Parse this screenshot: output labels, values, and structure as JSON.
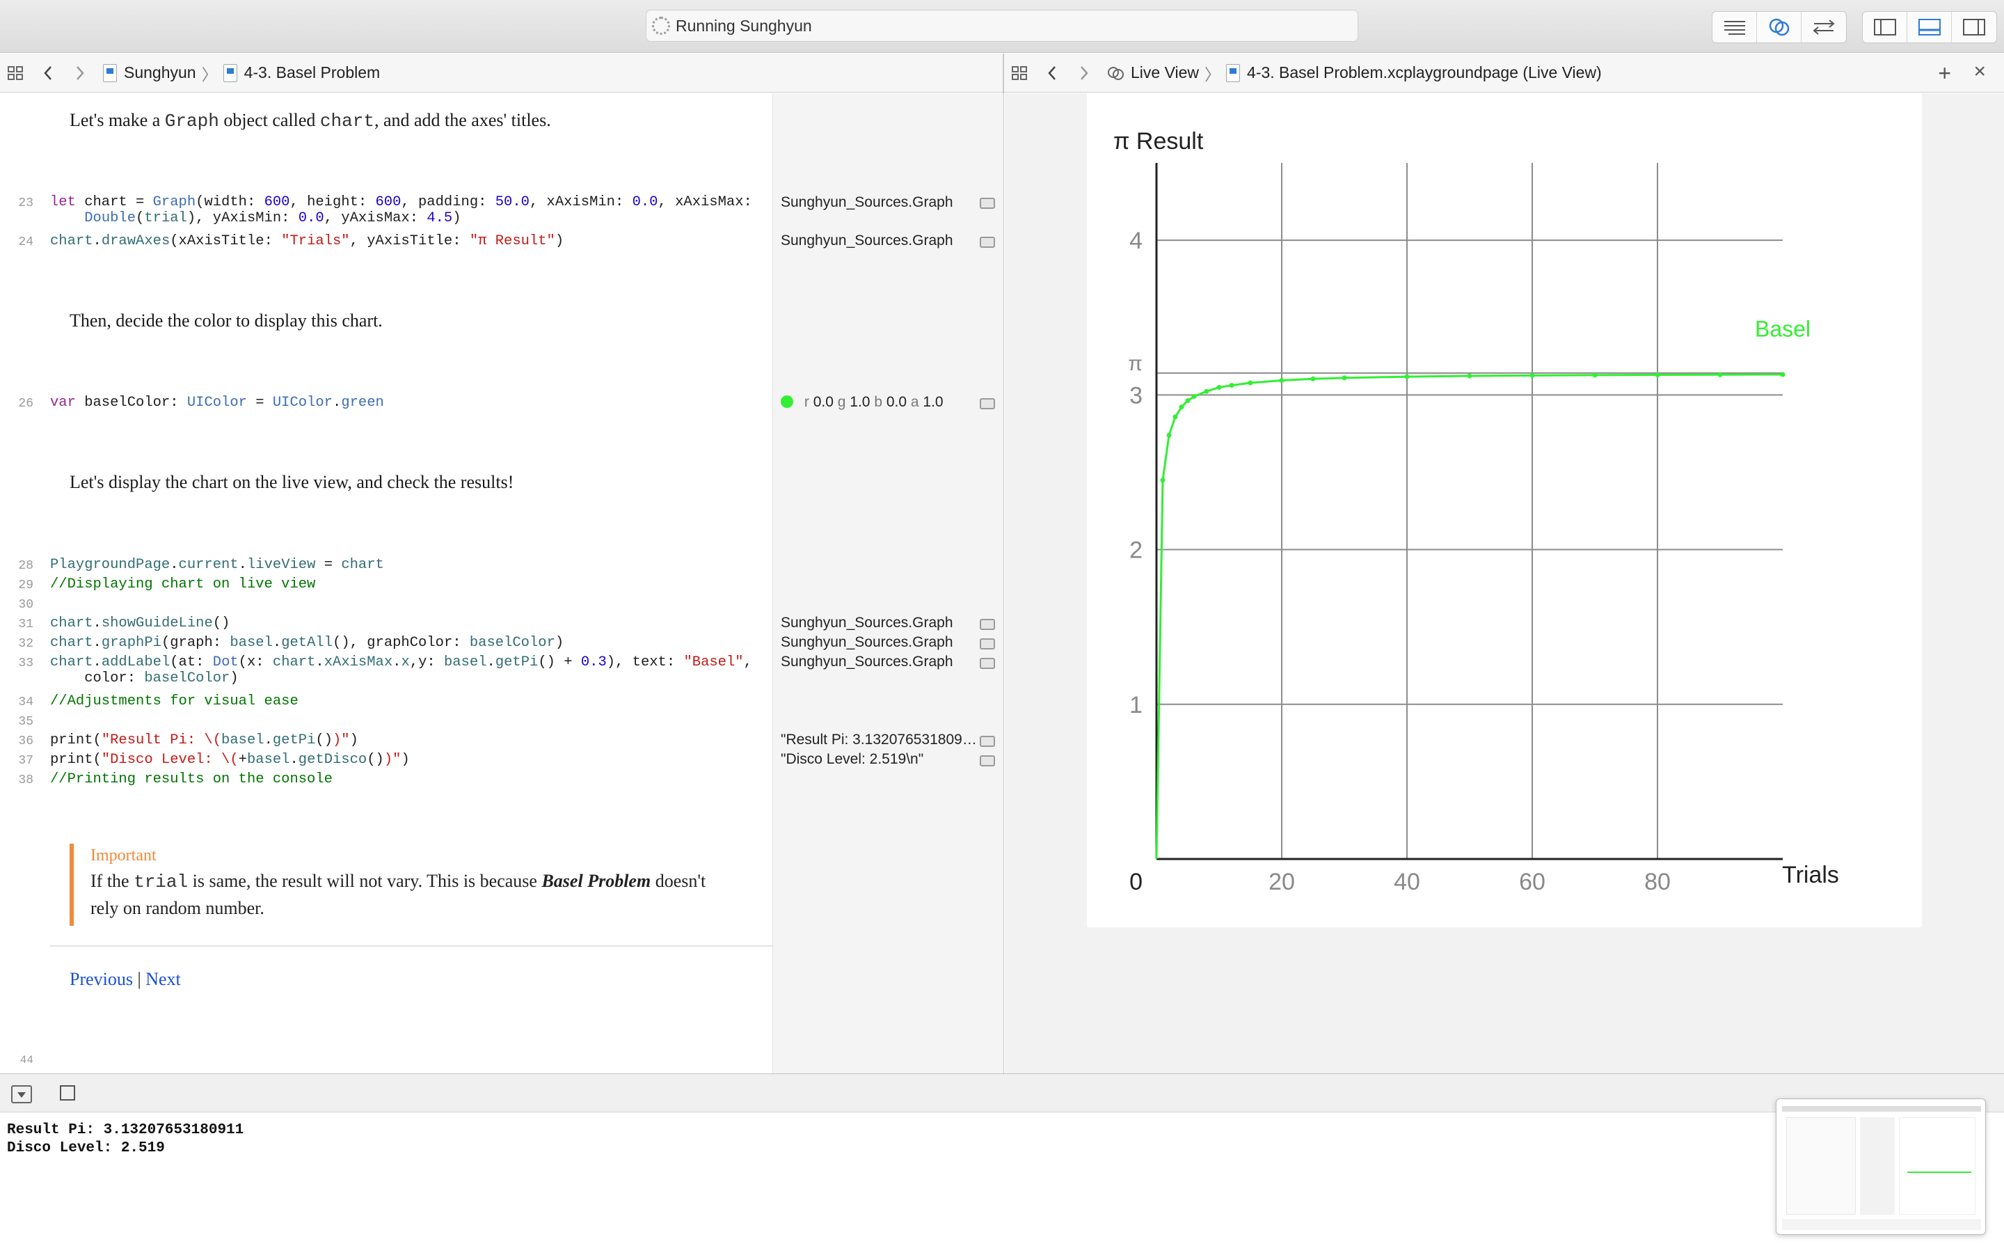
{
  "window": {
    "status": "Running Sunghyun"
  },
  "left_jump": {
    "crumb1": "Sunghyun",
    "crumb2": "4-3. Basel Problem"
  },
  "right_jump": {
    "crumb1": "Live View",
    "crumb2": "4-3. Basel Problem.xcplaygroundpage (Live View)"
  },
  "prose": {
    "p1_a": "Let's make a ",
    "p1_code1": "Graph",
    "p1_b": " object called ",
    "p1_code2": "chart",
    "p1_c": ", and add the axes' titles.",
    "p2": "Then, decide the color to display this chart.",
    "p3": "Let's display the chart on the live view, and check the results!"
  },
  "callout": {
    "title": "Important",
    "line1_a": "If the ",
    "line1_code": "trial",
    "line1_b": " is same, the result will not vary. This is because ",
    "line1_em": "Basel Problem",
    "line1_c": " doesn't",
    "line2": "rely on random number."
  },
  "nav": {
    "previous": "Previous",
    "sep": "|",
    "next": "Next"
  },
  "line_numbers": {
    "l23": "23",
    "l24": "24",
    "l26": "26",
    "l28": "28",
    "l29": "29",
    "l30": "30",
    "l31": "31",
    "l32": "32",
    "l33": "33",
    "l34": "34",
    "l35": "35",
    "l36": "36",
    "l37": "37",
    "l38": "38",
    "l44": "44"
  },
  "results": {
    "r23": "Sunghyun_Sources.Graph",
    "r24": "Sunghyun_Sources.Graph",
    "r26_r": "r",
    "r26_rv": "0.0",
    "r26_g": "g",
    "r26_gv": "1.0",
    "r26_b": "b",
    "r26_bv": "0.0",
    "r26_a": "a",
    "r26_av": "1.0",
    "r31": "Sunghyun_Sources.Graph",
    "r32": "Sunghyun_Sources.Graph",
    "r33": "Sunghyun_Sources.Graph",
    "r36": "\"Result Pi: 3.132076531809…",
    "r37": "\"Disco Level: 2.519\\n\""
  },
  "console": {
    "line1": "Result Pi: 3.13207653180911",
    "line2": "Disco Level: 2.519"
  },
  "colors": {
    "accent": "#2e7bd6",
    "series": "#33ee33",
    "callout": "#f08a3c"
  },
  "chart_data": {
    "type": "line",
    "title": "π Result",
    "xlabel": "Trials",
    "ylabel": "π Result",
    "xlim": [
      0,
      100
    ],
    "ylim": [
      0,
      4.5
    ],
    "x_ticks": [
      "20",
      "40",
      "60",
      "80"
    ],
    "y_ticks": [
      "1",
      "2",
      "3",
      "4"
    ],
    "origin_label": "0",
    "pi_label": "π",
    "pi_value": 3.14159,
    "grid": true,
    "series": [
      {
        "name": "Basel",
        "x": [
          1,
          2,
          3,
          4,
          5,
          6,
          8,
          10,
          12,
          15,
          20,
          25,
          30,
          40,
          50,
          60,
          70,
          80,
          90,
          100
        ],
        "values": [
          2.449,
          2.739,
          2.858,
          2.922,
          2.963,
          2.99,
          3.023,
          3.049,
          3.062,
          3.078,
          3.094,
          3.104,
          3.11,
          3.118,
          3.123,
          3.126,
          3.128,
          3.13,
          3.131,
          3.132
        ]
      }
    ]
  }
}
